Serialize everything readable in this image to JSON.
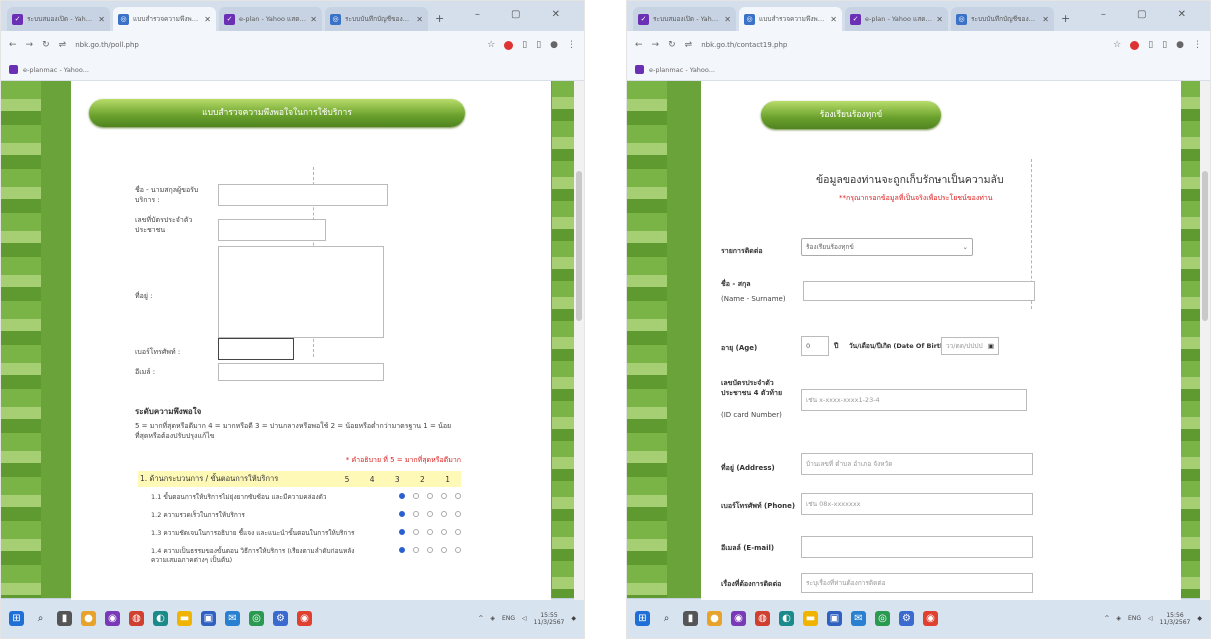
{
  "left": {
    "tabs": [
      {
        "label": "ระบบสมองเปิด - Yahoo แผลิตย่",
        "icon": "V"
      },
      {
        "label": "แบบสำรวจความพึงพอใจในการ",
        "icon": "G"
      },
      {
        "label": "e-plan - Yahoo แสดงผลการค้นหา",
        "icon": "V"
      },
      {
        "label": "ระบบบันทึกบัญชีของหน่วยงาน",
        "icon": "G"
      }
    ],
    "url": "nbk.go.th/poll.php",
    "bookmark": "e-planmac - Yahoo...",
    "banner": "แบบสำรวจความพึงพอใจในการใช้บริการ",
    "labels": {
      "name": "ชื่อ - นามสกุลผู้ขอรับบริการ :",
      "idcard": "เลขที่บัตรประจำตัวประชาชน",
      "address": "ที่อยู่ :",
      "phone": "เบอร์โทรศัพท์ :",
      "email": "อีเมล์ :"
    },
    "satisfaction_title": "ระดับความพึงพอใจ",
    "satisfaction_desc": "5 = มากที่สุดหรือดีมาก 4 = มากหรือดี 3 = ปานกลางหรือพอใช้ 2 = น้อยหรือต่ำกว่ามาตรฐาน 1 = น้อยที่สุดหรือต้องปรับปรุงแก้ไข",
    "note": "* คำอธิบาย ที่ 5 = มากที่สุดหรือดีมาก",
    "section_header": "1. ด้านกระบวนการ / ขั้นตอนการให้บริการ",
    "scale": "5 4 3 2 1",
    "questions": [
      "1.1 ขั้นตอนการให้บริการไม่ยุ่งยากซับซ้อน และมีความคล่องตัว",
      "1.2 ความรวดเร็วในการให้บริการ",
      "1.3 ความชัดเจนในการอธิบาย ชี้แจง และแนะนำขั้นตอนในการให้บริการ",
      "1.4 ความเป็นธรรมของขั้นตอน วิธีการให้บริการ (เรียงตามลำดับก่อนหลัง ความเสมอภาคต่างๆ เป็นต้น)"
    ],
    "clock": {
      "time": "15:55",
      "date": "11/3/2567"
    }
  },
  "right": {
    "tabs": [
      {
        "label": "ระบบสมองเปิด - Yahoo แผลิตย่",
        "icon": "V"
      },
      {
        "label": "แบบสำรวจความพึงพอใจ",
        "icon": "G"
      },
      {
        "label": "e-plan - Yahoo แสดงผลการค้นหา",
        "icon": "V"
      },
      {
        "label": "ระบบบันทึกบัญชีของหน่วยงาน",
        "icon": "G"
      }
    ],
    "url": "nbk.go.th/contact19.php",
    "bookmark": "e-planmac - Yahoo...",
    "banner": "ร้องเรียนร้องทุกข์",
    "heading": "ข้อมูลของท่านจะถูกเก็บรักษาเป็นความลับ",
    "subheading": "**กรุณากรอกข้อมูลที่เป็นจริงเพื่อประโยชน์ของท่าน",
    "labels": {
      "contact_type": "รายการติดต่อ",
      "name": "ชื่อ - สกุล",
      "name_en": "(Name - Surname)",
      "age": "อายุ (Age)",
      "age_unit": "ปี",
      "dob": "วัน/เดือน/ปีเกิด (Date Of Birth)",
      "idcard": "เลขบัตรประจำตัวประชาชน 4 ตัวท้าย",
      "idcard_en": "(ID card Number)",
      "address": "ที่อยู่ (Address)",
      "phone": "เบอร์โทรศัพท์ (Phone)",
      "email": "อีเมลล์ (E-mail)",
      "subject": "เรื่องที่ต้องการติดต่อ"
    },
    "values": {
      "contact_type": "ร้องเรียนร้องทุกข์",
      "age": "0"
    },
    "placeholders": {
      "dob": "วว/ดด/ปปปป",
      "idcard": "เช่น x-xxxx-xxxx1-23-4",
      "address": "บ้านเลขที่ ตำบล อำเภอ จังหวัด",
      "phone": "เช่น 08x-xxxxxxx",
      "subject": "ระบุเรื่องที่ท่านต้องการติดต่อ"
    },
    "clock": {
      "time": "15:56",
      "date": "11/3/2567"
    }
  }
}
